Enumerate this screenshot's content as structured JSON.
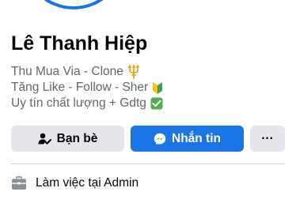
{
  "profile": {
    "name": "Lê Thanh Hiệp",
    "bio": [
      {
        "text": "Thu Mua Via - Clone",
        "icon": "trident-icon"
      },
      {
        "text": "Tăng Like - Follow - Sher",
        "icon": "beginner-badge-icon"
      },
      {
        "text": "Uy tín chất lượng + Gdtg",
        "icon": "check-mark-button-icon"
      }
    ]
  },
  "actions": {
    "friends_label": "Bạn bè",
    "message_label": "Nhắn tin",
    "more_label": "···"
  },
  "about": {
    "work_label": "Làm việc tại Admin"
  },
  "colors": {
    "primary": "#1b74e4",
    "secondary_button": "#e4e6eb",
    "text": "#050505",
    "muted_text": "#65676b",
    "divider": "#ced0d4"
  }
}
